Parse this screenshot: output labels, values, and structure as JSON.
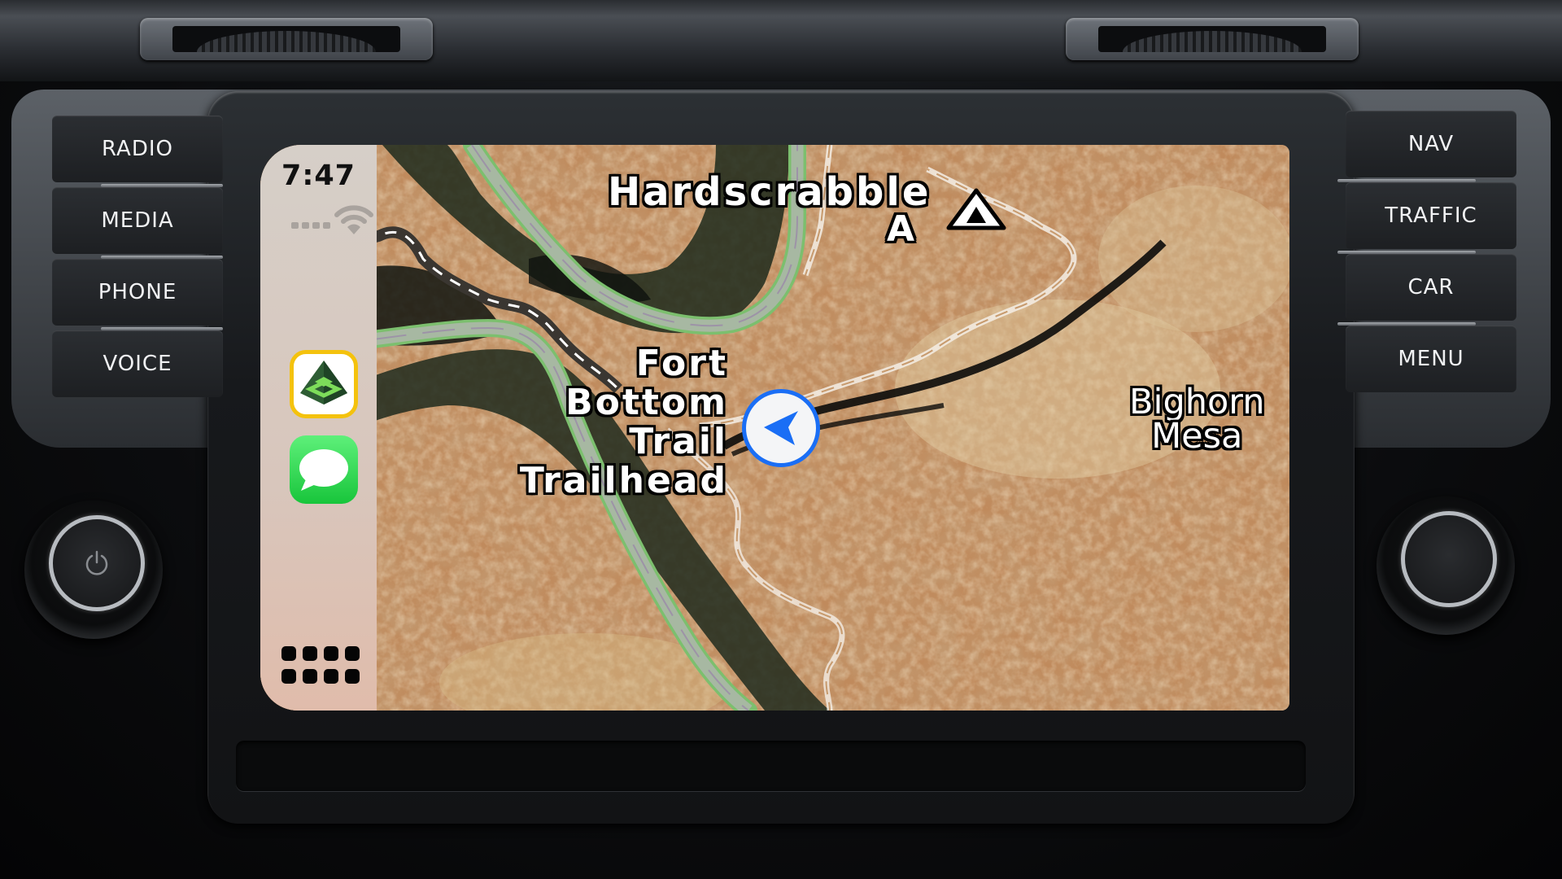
{
  "head_unit": {
    "left_buttons": [
      {
        "id": "radio",
        "label": "RADIO"
      },
      {
        "id": "media",
        "label": "MEDIA"
      },
      {
        "id": "phone",
        "label": "PHONE"
      },
      {
        "id": "voice",
        "label": "VOICE"
      }
    ],
    "right_buttons": [
      {
        "id": "nav",
        "label": "NAV"
      },
      {
        "id": "traffic",
        "label": "TRAFFIC"
      },
      {
        "id": "car",
        "label": "CAR"
      },
      {
        "id": "menu",
        "label": "MENU"
      }
    ],
    "left_knob_icon": "power-icon",
    "right_knob_icon": "none"
  },
  "carplay": {
    "status_bar": {
      "time": "7:47",
      "signal_bars": 4,
      "wifi_icon": "wifi-icon"
    },
    "dock_apps": [
      {
        "name": "Gaia GPS",
        "icon": "gaia-gps-icon",
        "active": true,
        "highlight_color": "#f4c20d"
      },
      {
        "name": "Messages",
        "icon": "messages-icon",
        "active": false
      }
    ],
    "home_button_icon": "app-grid-icon",
    "colors": {
      "sidebar": "#d8c6bc",
      "active_border": "#f4c20d",
      "messages_green": "#2bd14c",
      "nav_blue": "#1a6ef5"
    }
  },
  "map": {
    "labels": [
      {
        "id": "hardscrabble",
        "text": "Hardscrabble"
      },
      {
        "id": "hardscrabble_a",
        "text": "A"
      },
      {
        "id": "fort_bottom_1",
        "text": "Fort"
      },
      {
        "id": "fort_bottom_2",
        "text": "Bottom"
      },
      {
        "id": "fort_bottom_3",
        "text": "Trail"
      },
      {
        "id": "fort_bottom_4",
        "text": "Trailhead"
      },
      {
        "id": "bighorn_1",
        "text": "Bighorn"
      },
      {
        "id": "bighorn_2",
        "text": "Mesa"
      }
    ],
    "markers": [
      {
        "type": "campsite",
        "icon": "tent-icon"
      },
      {
        "type": "current-location",
        "icon": "nav-arrow-icon"
      }
    ]
  }
}
